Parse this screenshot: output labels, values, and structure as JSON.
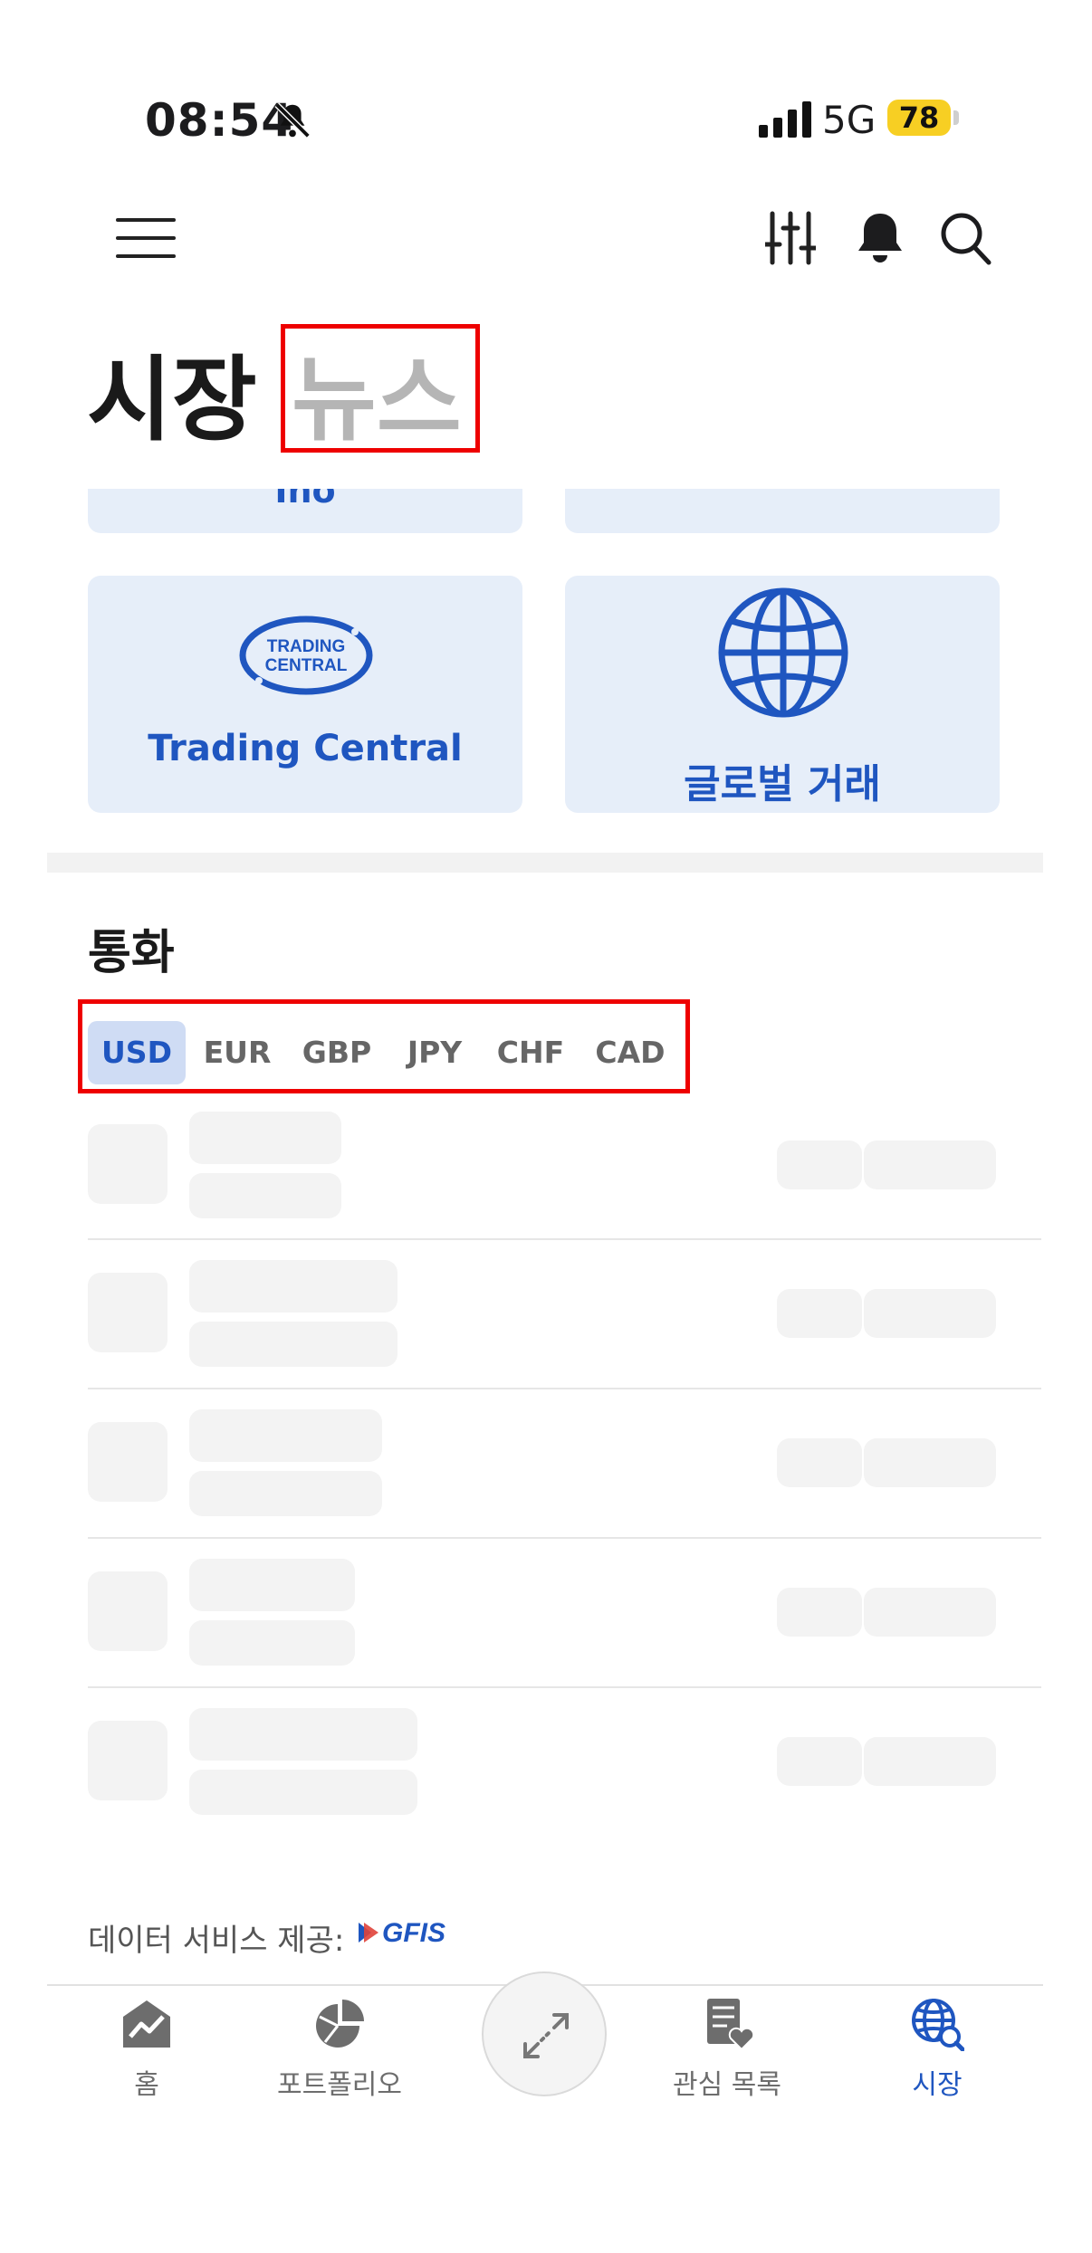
{
  "status_bar": {
    "time": "08:54",
    "network": "5G",
    "battery": "78"
  },
  "header": {
    "title": "시장",
    "secondary_title": "뉴스"
  },
  "cards": {
    "partial_left_label": "Ino",
    "trading_central": {
      "label": "Trading Central",
      "logo_line1": "TRADING",
      "logo_line2": "CENTRAL"
    },
    "global": {
      "label": "글로벌 거래"
    }
  },
  "currency": {
    "section_title": "통화",
    "tabs": [
      {
        "label": "USD",
        "active": true
      },
      {
        "label": "EUR",
        "active": false
      },
      {
        "label": "GBP",
        "active": false
      },
      {
        "label": "JPY",
        "active": false
      },
      {
        "label": "CHF",
        "active": false
      },
      {
        "label": "CAD",
        "active": false
      }
    ]
  },
  "provider": {
    "label": "데이터 서비스 제공:",
    "logo": "GFIS"
  },
  "bottom_nav": {
    "items": [
      {
        "label": "홈",
        "icon": "home-chart-icon",
        "active": false
      },
      {
        "label": "포트폴리오",
        "icon": "pie-chart-icon",
        "active": false
      },
      {
        "label": "",
        "icon": "expand-arrows-icon",
        "active": false
      },
      {
        "label": "관심 목록",
        "icon": "watchlist-icon",
        "active": false
      },
      {
        "label": "시장",
        "icon": "market-globe-icon",
        "active": true
      }
    ]
  },
  "colors": {
    "accent": "#1f56c0",
    "card_bg": "#e6eef9",
    "highlight_box": "#ee0000",
    "battery": "#f7cf23"
  }
}
